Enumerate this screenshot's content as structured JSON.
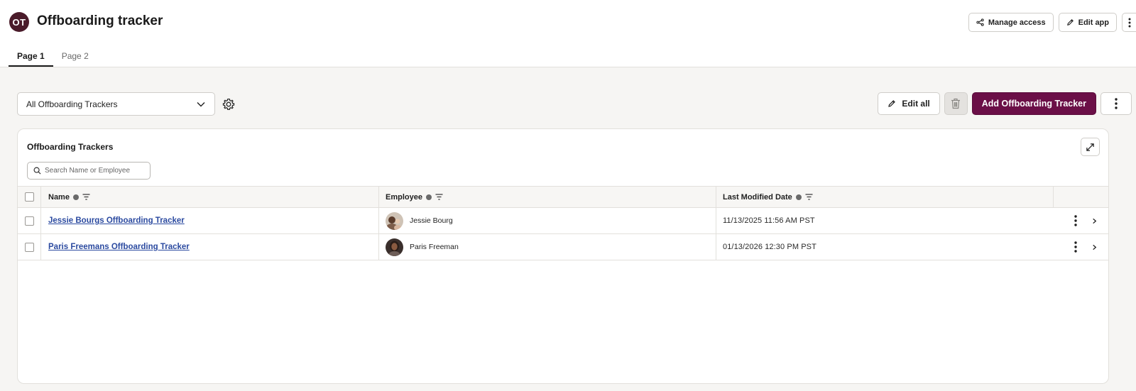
{
  "app": {
    "avatar_initials": "OT",
    "title": "Offboarding tracker",
    "manage_access_label": "Manage access",
    "edit_app_label": "Edit app"
  },
  "tabs": [
    {
      "label": "Page 1",
      "active": true
    },
    {
      "label": "Page 2",
      "active": false
    }
  ],
  "toolbar": {
    "view_selected": "All Offboarding Trackers",
    "edit_all_label": "Edit all",
    "add_label": "Add Offboarding Tracker"
  },
  "table": {
    "title": "Offboarding Trackers",
    "search_placeholder": "Search Name or Employee",
    "columns": [
      {
        "label": "Name"
      },
      {
        "label": "Employee"
      },
      {
        "label": "Last Modified Date"
      }
    ],
    "rows": [
      {
        "name": "Jessie Bourgs Offboarding Tracker",
        "employee": "Jessie Bourg",
        "last_modified": "11/13/2025 11:56 AM PST"
      },
      {
        "name": "Paris Freemans Offboarding Tracker",
        "employee": "Paris Freeman",
        "last_modified": "01/13/2026 12:30 PM PST"
      }
    ]
  },
  "colors": {
    "brand_primary": "#6b0f47",
    "app_avatar_bg": "#4a1b2a",
    "link": "#2b4aa0"
  }
}
